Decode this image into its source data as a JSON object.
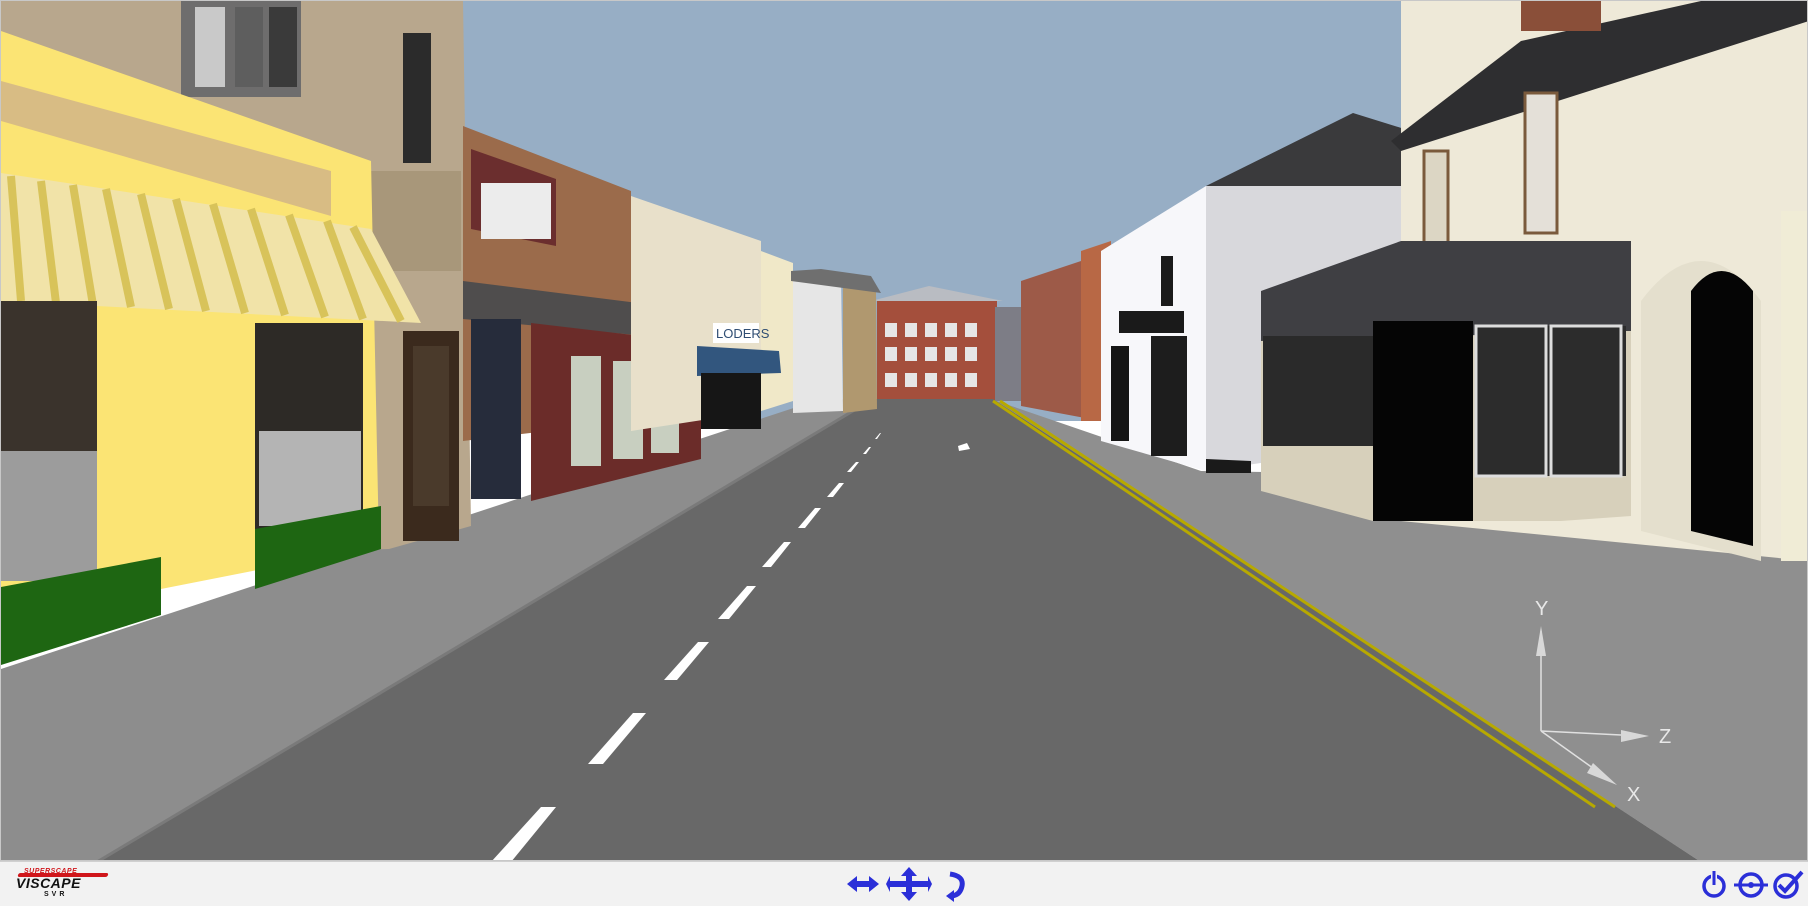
{
  "app": {
    "logo_top": "SUPERSCAPE",
    "logo_main": "VISCAPE",
    "logo_sub": "SVR"
  },
  "scene": {
    "shop_signs": [
      "LODERS",
      "LODERS"
    ],
    "axes": {
      "y": "Y",
      "z": "Z",
      "x": "X"
    }
  },
  "toolbar": {
    "left_buttons": [
      "pan-arrows-icon",
      "move-cross-icon",
      "rotate-icon"
    ],
    "right_buttons": [
      "power-icon",
      "step-icon",
      "check-icon"
    ]
  },
  "colors": {
    "sky": "#97aec5",
    "road": "#686868",
    "pavement": "#8f8f8f",
    "toolbar_icons": "#2b2fd8"
  }
}
